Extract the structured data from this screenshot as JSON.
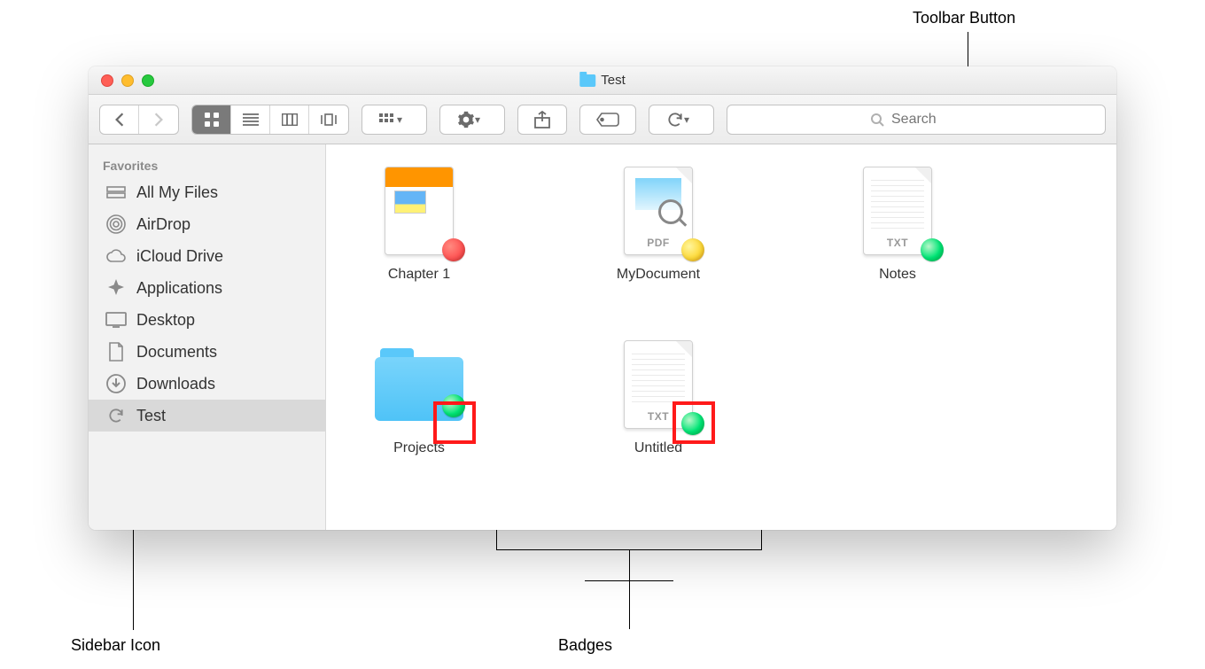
{
  "window": {
    "title": "Test"
  },
  "toolbar": {
    "search_placeholder": "Search"
  },
  "sidebar": {
    "heading": "Favorites",
    "items": [
      {
        "icon": "all-my-files-icon",
        "label": "All My Files"
      },
      {
        "icon": "airdrop-icon",
        "label": "AirDrop"
      },
      {
        "icon": "icloud-drive-icon",
        "label": "iCloud Drive"
      },
      {
        "icon": "applications-icon",
        "label": "Applications"
      },
      {
        "icon": "desktop-icon",
        "label": "Desktop"
      },
      {
        "icon": "documents-icon",
        "label": "Documents"
      },
      {
        "icon": "downloads-icon",
        "label": "Downloads"
      },
      {
        "icon": "sync-icon",
        "label": "Test",
        "active": true
      }
    ]
  },
  "files": [
    {
      "name": "Chapter 1",
      "kind": "pages",
      "badge": "red",
      "highlight": false
    },
    {
      "name": "MyDocument",
      "kind": "pdf",
      "ext": "PDF",
      "badge": "yellow",
      "highlight": false
    },
    {
      "name": "Notes",
      "kind": "txt",
      "ext": "TXT",
      "badge": "green",
      "highlight": false
    },
    {
      "name": "Projects",
      "kind": "folder",
      "badge": "green",
      "highlight": true
    },
    {
      "name": "Untitled",
      "kind": "txt",
      "ext": "TXT",
      "badge": "green",
      "highlight": true
    }
  ],
  "callouts": {
    "toolbar_button": "Toolbar Button",
    "badges": "Badges",
    "sidebar_icon": "Sidebar Icon"
  }
}
